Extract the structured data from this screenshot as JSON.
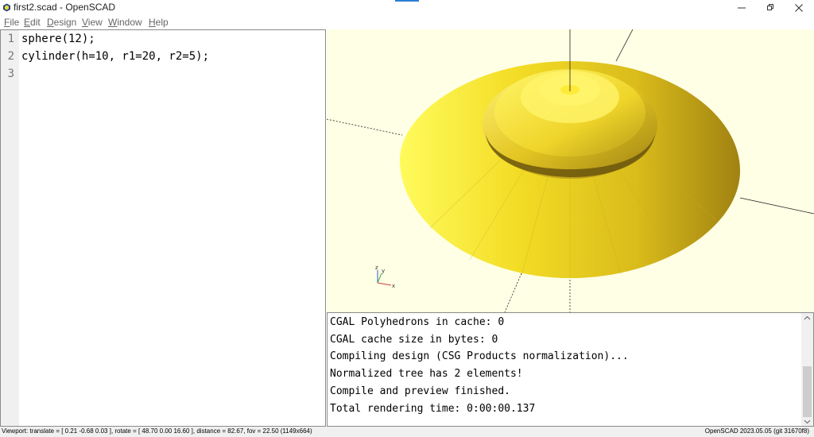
{
  "window": {
    "title": "first2.scad - OpenSCAD",
    "app_icon": "openscad-icon",
    "controls": [
      "minimize-icon",
      "restore-icon",
      "close-icon"
    ],
    "accent_color": "#2d7fd2"
  },
  "menu": {
    "items": [
      {
        "mnemonic": "F",
        "rest": "ile"
      },
      {
        "mnemonic": "E",
        "rest": "dit"
      },
      {
        "mnemonic": "D",
        "rest": "esign"
      },
      {
        "mnemonic": "V",
        "rest": "iew"
      },
      {
        "mnemonic": "W",
        "rest": "indow"
      },
      {
        "mnemonic": "H",
        "rest": "elp"
      }
    ]
  },
  "editor": {
    "lines": [
      {
        "no": "1",
        "code": "sphere(12);"
      },
      {
        "no": "2",
        "code": "cylinder(h=10, r1=20, r2=5);"
      },
      {
        "no": "3",
        "code": ""
      }
    ]
  },
  "viewport": {
    "background_color": "#ffffe5",
    "model_color": "#f8e41c",
    "axis_labels": {
      "x": "x",
      "y": "y",
      "z": "z"
    }
  },
  "console": {
    "lines": [
      "CGAL Polyhedrons in cache: 0",
      "CGAL cache size in bytes: 0",
      "Compiling design (CSG Products normalization)...",
      "Normalized tree has 2 elements!",
      "Compile and preview finished.",
      "Total rendering time: 0:00:00.137"
    ]
  },
  "status": {
    "viewport_info": "Viewport: translate = [ 0.21 -0.68 0.03 ], rotate = [ 48.70 0.00 16.60 ], distance = 82.67, fov = 22.50 (1149x664)",
    "version": "OpenSCAD 2023.05.05 (git 31670f8)"
  }
}
